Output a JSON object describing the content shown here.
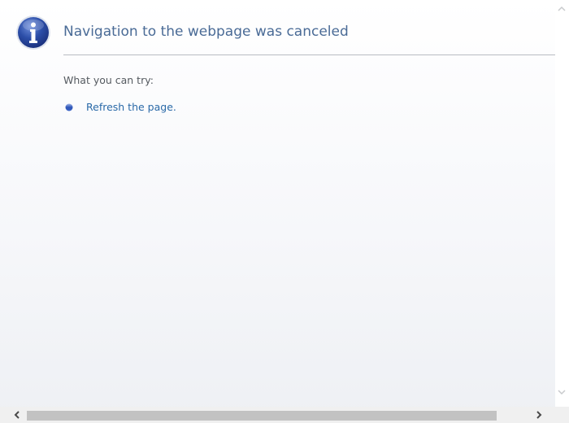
{
  "error_page": {
    "title": "Navigation to the webpage was canceled",
    "subheading": "What you can try:",
    "suggestions": [
      {
        "label": "Refresh the page."
      }
    ]
  },
  "icons": {
    "header": "info-icon",
    "bullet": "bullet-icon",
    "scroll_up": "chevron-up-icon",
    "scroll_down": "chevron-down-icon",
    "scroll_left": "chevron-left-icon",
    "scroll_right": "chevron-right-icon"
  },
  "colors": {
    "title": "#4a6b96",
    "link": "#2a6aa8",
    "icon_blue": "#2d4fa8",
    "divider": "#b9bcc2"
  }
}
